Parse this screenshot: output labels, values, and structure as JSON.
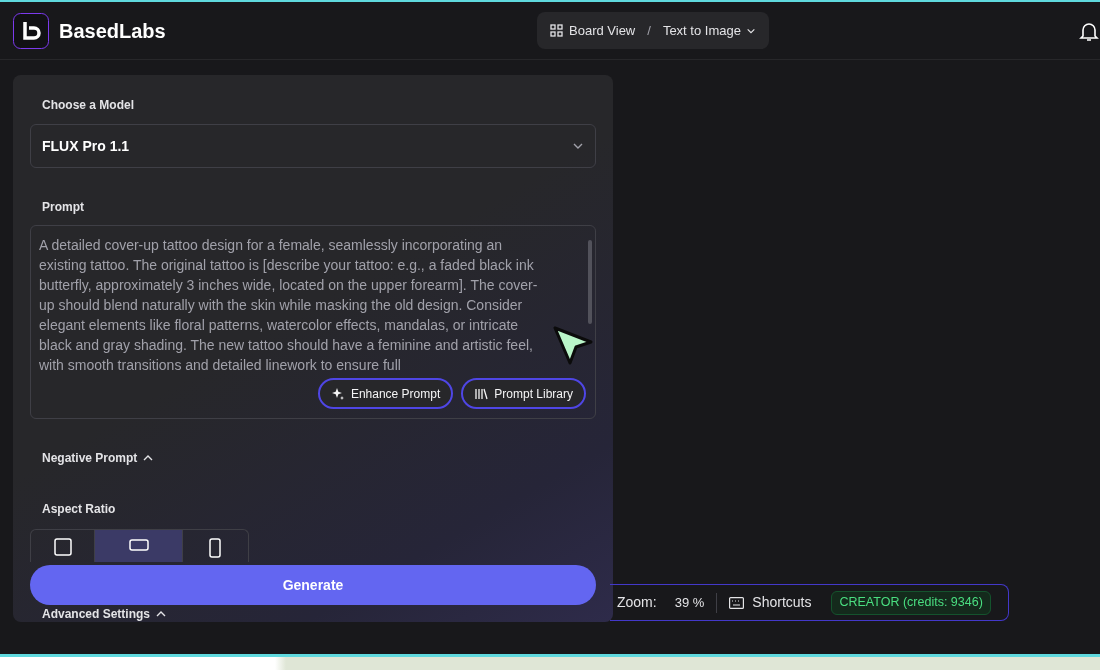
{
  "brand": {
    "name": "BasedLabs"
  },
  "breadcrumb": [
    {
      "label": "Board View",
      "kind": "board"
    },
    {
      "label": "/",
      "kind": "separator"
    },
    {
      "label": "Text to Image",
      "kind": "dropdown"
    }
  ],
  "panel": {
    "model_label": "Choose a Model",
    "model": "FLUX Pro 1.1",
    "prompt_label": "Prompt",
    "prompt": "A detailed cover-up tattoo design for a female, seamlessly incorporating an existing tattoo. The original tattoo is [describe your tattoo: e.g., a faded black ink butterfly, approximately 3 inches wide, located on the upper forearm]. The cover-up should blend naturally with the skin while masking the old design. Consider elegant elements like floral patterns, watercolor effects, mandalas, or intricate black and gray shading. The new tattoo should have a feminine and artistic feel, with smooth transitions and detailed linework to ensure full",
    "prompt_buttons": [
      {
        "label": "Enhance Prompt",
        "kind": "sparkle"
      },
      {
        "label": "Prompt Library",
        "kind": "library"
      }
    ],
    "negative_label": "Negative Prompt",
    "negative_expanded": true,
    "aspect_label": "Aspect Ratio",
    "aspects": [
      {
        "kind": "square",
        "selected": false
      },
      {
        "kind": "landscape",
        "selected": true
      },
      {
        "kind": "portrait",
        "selected": false
      }
    ],
    "generate": "Generate",
    "advanced_label": "Advanced Settings",
    "advanced_expanded": true
  },
  "status_bar": {
    "zoom_label": "Zoom:",
    "zoom": "39 %",
    "shortcuts": "Shortcuts",
    "plan": "CREATOR (credits: 9346)"
  }
}
